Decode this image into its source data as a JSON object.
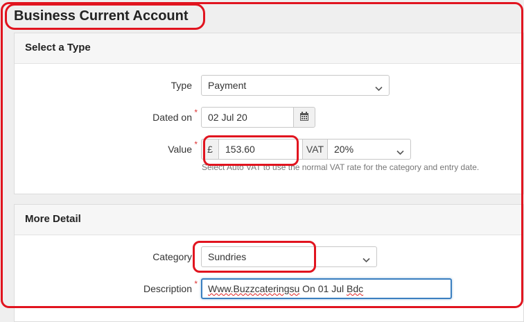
{
  "page": {
    "title": "Business Current Account"
  },
  "select_type": {
    "heading": "Select a Type",
    "type_label": "Type",
    "type_value": "Payment",
    "dated_label": "Dated on",
    "date_value": "02 Jul 20",
    "value_label": "Value",
    "currency_symbol": "£",
    "amount": "153.60",
    "vat_label": "VAT",
    "vat_value": "20%",
    "help_text": "Select Auto VAT to use the normal VAT rate for the category and entry date.",
    "required_marker": "*"
  },
  "more_detail": {
    "heading": "More Detail",
    "category_label": "Category",
    "category_value": "Sundries",
    "description_label": "Description",
    "description_prefix": "Www.Buzzcateringsu",
    "description_middle": " On 01 Jul ",
    "description_suffix": "Bdc",
    "required_marker": "*"
  },
  "annotation": {
    "color": "#e1141f"
  }
}
